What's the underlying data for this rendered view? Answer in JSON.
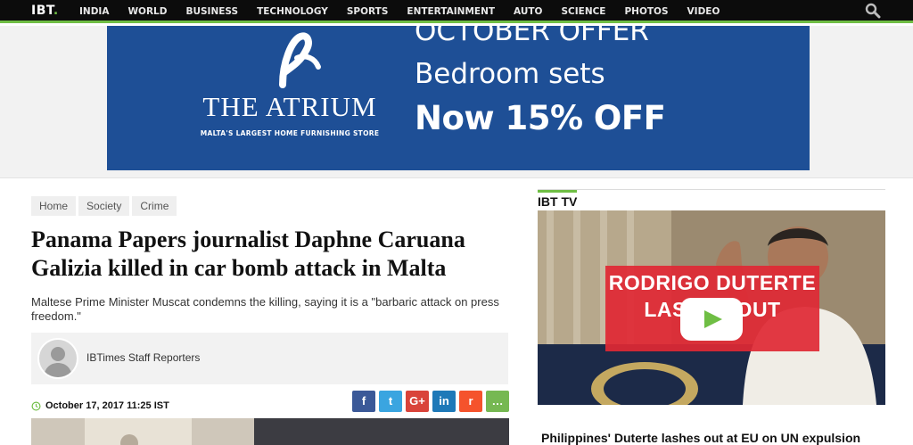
{
  "nav": {
    "logo": "IBT",
    "logo_dot": ".",
    "items": [
      "INDIA",
      "WORLD",
      "BUSINESS",
      "TECHNOLOGY",
      "SPORTS",
      "ENTERTAINMENT",
      "AUTO",
      "SCIENCE",
      "PHOTOS",
      "VIDEO"
    ]
  },
  "ad": {
    "brand": "THE ATRIUM",
    "tagline": "MALTA'S LARGEST HOME FURNISHING STORE",
    "line1": "OCTOBER OFFER",
    "line2": "Bedroom sets",
    "line3": "Now 15% OFF"
  },
  "article": {
    "breadcrumbs": [
      "Home",
      "Society",
      "Crime"
    ],
    "headline": "Panama Papers journalist Daphne Caruana Galizia killed in car bomb attack in Malta",
    "summary": "Maltese Prime Minister Muscat condemns the killing, saying it is a \"barbaric attack on press freedom.\"",
    "author": "IBTimes Staff Reporters",
    "date": "October 17, 2017 11:25 IST"
  },
  "share": [
    {
      "icon": "facebook-icon",
      "glyph": "f",
      "color": "#3b5998"
    },
    {
      "icon": "twitter-icon",
      "glyph": "t",
      "color": "#3aa5e0"
    },
    {
      "icon": "google-plus-icon",
      "glyph": "G+",
      "color": "#d9433a"
    },
    {
      "icon": "linkedin-icon",
      "glyph": "in",
      "color": "#1e79b8"
    },
    {
      "icon": "reddit-icon",
      "glyph": "r",
      "color": "#f5532c"
    },
    {
      "icon": "comment-icon",
      "glyph": "…",
      "color": "#76b852"
    }
  ],
  "sidebar": {
    "section_title": "IBT TV",
    "video_title_1": "RODRIGO DUTERTE",
    "video_title_2": "LASHES OUT",
    "video_caption": "Philippines' Duterte lashes out at EU on UN expulsion"
  },
  "colors": {
    "accent": "#6fbe44",
    "ad_blue": "#1e4f96",
    "nav_bg": "#0c0c0c"
  }
}
